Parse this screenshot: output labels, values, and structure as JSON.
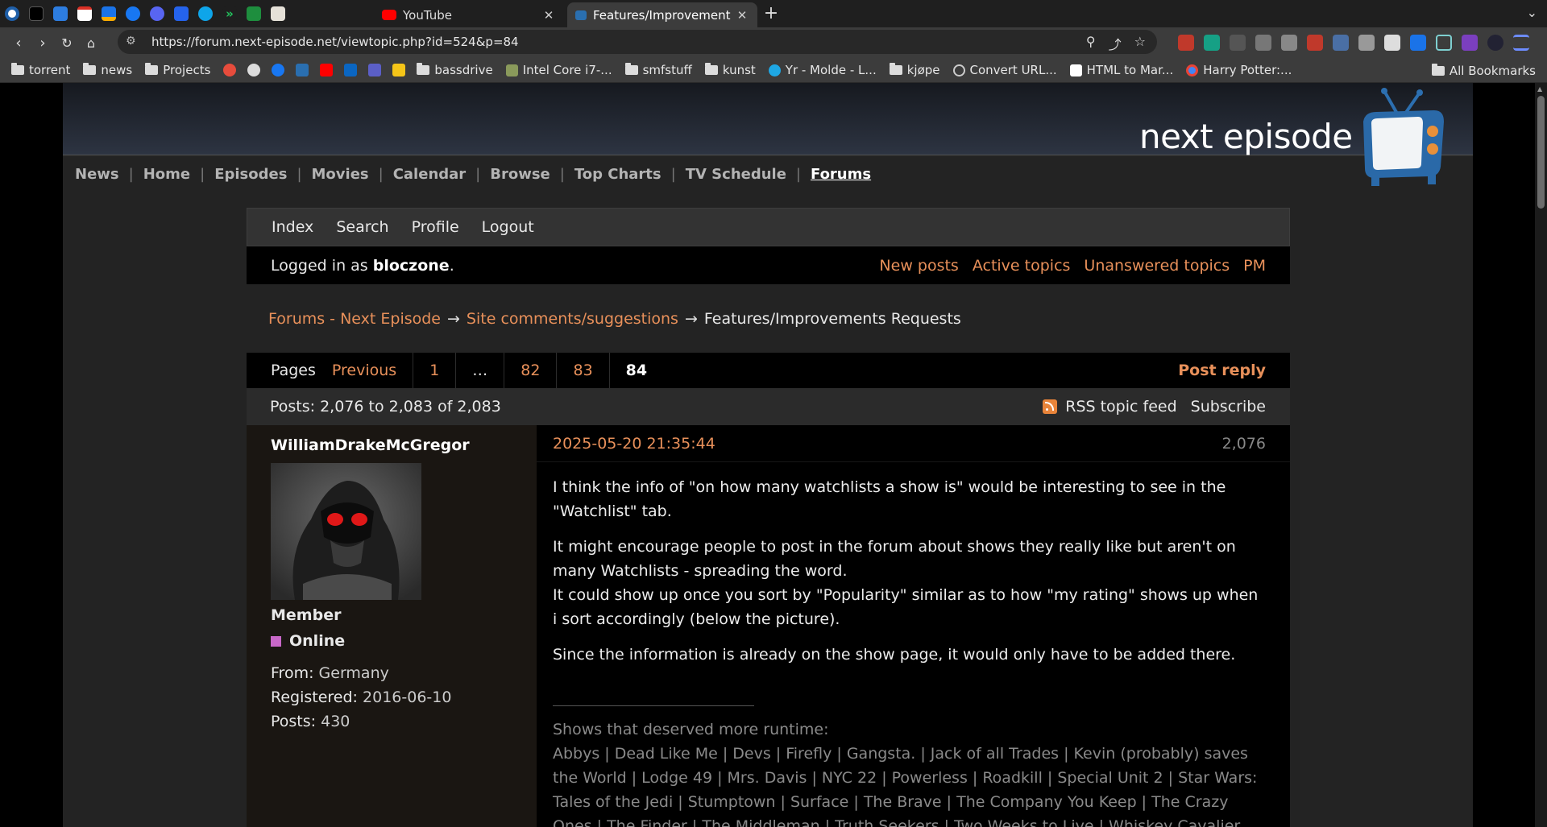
{
  "browser": {
    "tabs": [
      {
        "title": "YouTube",
        "active": false
      },
      {
        "title": "Features/Improvement",
        "active": true
      }
    ],
    "url": "https://forum.next-episode.net/viewtopic.php?id=524&p=84",
    "bookmarks": [
      "torrent",
      "news",
      "Projects",
      "bassdrive",
      "Intel Core i7-...",
      "smfstuff",
      "kunst",
      "Yr - Molde - L...",
      "kjøpe",
      "Convert URL...",
      "HTML to Mar...",
      "Harry Potter:..."
    ],
    "all_bookmarks": "All Bookmarks"
  },
  "site": {
    "logo_text": "next episode",
    "nav": [
      "News",
      "Home",
      "Episodes",
      "Movies",
      "Calendar",
      "Browse",
      "Top Charts",
      "TV Schedule",
      "Forums"
    ]
  },
  "forum": {
    "menu": [
      "Index",
      "Search",
      "Profile",
      "Logout"
    ],
    "logged_in_prefix": "Logged in as ",
    "username": "bloczone",
    "logged_in_suffix": ".",
    "quick_links": [
      "New posts",
      "Active topics",
      "Unanswered topics",
      "PM"
    ],
    "breadcrumb": [
      "Forums - Next Episode",
      "Site comments/suggestions",
      "Features/Improvements Requests"
    ],
    "breadcrumb_sep": "→",
    "pages_label": "Pages",
    "pages": [
      "Previous",
      "1",
      "…",
      "82",
      "83",
      "84"
    ],
    "post_reply": "Post reply",
    "post_count": "Posts: 2,076 to 2,083 of 2,083",
    "rss": "RSS topic feed",
    "subscribe": "Subscribe"
  },
  "post": {
    "author": "WilliamDrakeMcGregor",
    "rank": "Member",
    "status": "Online",
    "from_label": "From:",
    "from": "Germany",
    "registered_label": "Registered:",
    "registered": "2016-06-10",
    "posts_label": "Posts:",
    "posts": "430",
    "datetime": "2025-05-20 21:35:44",
    "number": "2,076",
    "paragraphs": [
      "I think the info of \"on how many watchlists a show is\" would be interesting to see in the \"Watchlist\" tab.",
      "It might encourage people to post in the forum about shows they really like but aren't on many Watchlists - spreading the word.",
      "It could show up once you sort by \"Popularity\" similar as to how \"my rating\" shows up when i sort accordingly (below the picture).",
      "Since the information is already on the show page, it would only have to be added there."
    ],
    "signature_title": "Shows that deserved more runtime:",
    "signature": "Abbys | Dead Like Me | Devs | Firefly | Gangsta. | Jack of all Trades | Kevin (probably) saves the World | Lodge 49 | Mrs. Davis | NYC 22 | Powerless | Roadkill | Special Unit 2 | Star Wars: Tales of the Jedi | Stumptown | Surface | The Brave | The Company You Keep | The Crazy Ones | The Finder | The Middleman | Truth Seekers | Two Weeks to Live | Whiskey Cavalier"
  },
  "colors": {
    "accent": "#e8905a",
    "online": "#c868c8"
  }
}
